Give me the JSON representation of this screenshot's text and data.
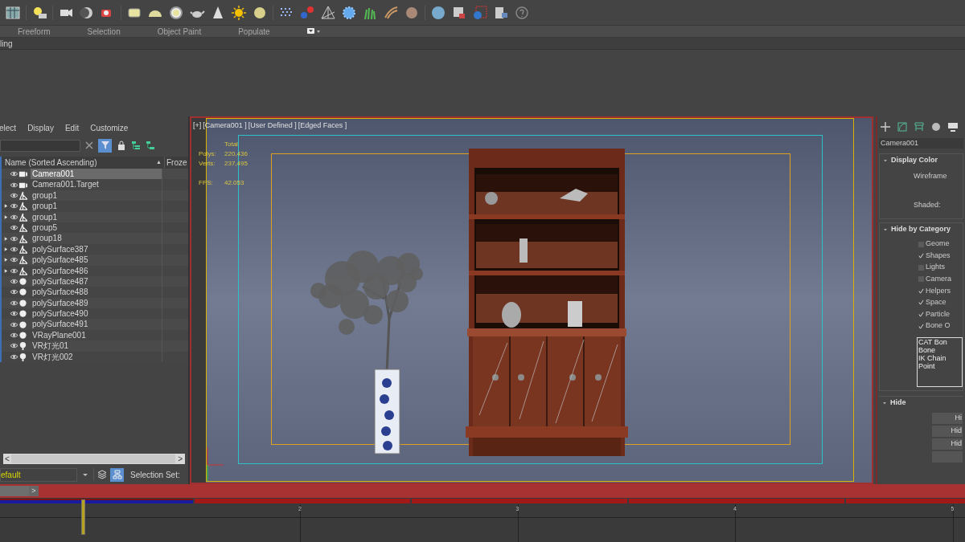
{
  "ribbon": {
    "tabs": [
      {
        "label": "Freeform",
        "selected": false
      },
      {
        "label": "Selection",
        "selected": false
      },
      {
        "label": "Object Paint",
        "selected": false
      },
      {
        "label": "Populate",
        "selected": false
      }
    ],
    "panel_tab": "ling"
  },
  "scene_explorer": {
    "menu": [
      "elect",
      "Display",
      "Edit",
      "Customize"
    ],
    "filter_active": true,
    "columns": [
      "Name (Sorted Ascending)",
      "Froze"
    ],
    "sort_mark": "▲",
    "rows": [
      {
        "name": "Camera001",
        "kind": "camera",
        "expander": false,
        "selected": true
      },
      {
        "name": "Camera001.Target",
        "kind": "camera",
        "expander": false,
        "selected": false
      },
      {
        "name": "group1",
        "kind": "shape",
        "expander": false,
        "selected": false
      },
      {
        "name": "group1",
        "kind": "shape",
        "expander": true,
        "selected": false
      },
      {
        "name": "group1",
        "kind": "shape",
        "expander": true,
        "selected": false
      },
      {
        "name": "group5",
        "kind": "shape",
        "expander": false,
        "selected": false
      },
      {
        "name": "group18",
        "kind": "shape",
        "expander": true,
        "selected": false
      },
      {
        "name": "polySurface387",
        "kind": "shape",
        "expander": true,
        "selected": false
      },
      {
        "name": "polySurface485",
        "kind": "shape",
        "expander": true,
        "selected": false
      },
      {
        "name": "polySurface486",
        "kind": "shape",
        "expander": true,
        "selected": false
      },
      {
        "name": "polySurface487",
        "kind": "geometry",
        "expander": false,
        "selected": false
      },
      {
        "name": "polySurface488",
        "kind": "geometry",
        "expander": false,
        "selected": false
      },
      {
        "name": "polySurface489",
        "kind": "geometry",
        "expander": false,
        "selected": false
      },
      {
        "name": "polySurface490",
        "kind": "geometry",
        "expander": false,
        "selected": false
      },
      {
        "name": "polySurface491",
        "kind": "geometry",
        "expander": false,
        "selected": false
      },
      {
        "name": "VRayPlane001",
        "kind": "geometry",
        "expander": false,
        "selected": false
      },
      {
        "name": "VR灯光01",
        "kind": "light",
        "expander": false,
        "selected": false
      },
      {
        "name": "VR灯光002",
        "kind": "light",
        "expander": false,
        "selected": false
      }
    ],
    "scroll_left": "<",
    "scroll_right": ">",
    "layer": "efault",
    "hierarchy_mode": true,
    "selection_set_label": "Selection Set:"
  },
  "viewport": {
    "labels": [
      "[+]",
      "[Camera001 ]",
      "[User Defined ]",
      "[Edged Faces ]"
    ],
    "stats_header": "Total",
    "stats": [
      {
        "label": "Polys:",
        "value": "220,436"
      },
      {
        "label": "Verts:",
        "value": "237,495"
      },
      {
        "label": "FPS:",
        "value": "42.053"
      }
    ]
  },
  "command_panel": {
    "object_name": "Camera001",
    "display_color": {
      "title": "Display Color",
      "labels": [
        "Wireframe",
        "Shaded:"
      ]
    },
    "hide_by_category": {
      "title": "Hide by Category",
      "checkboxes": [
        {
          "label": "Geome",
          "checked": false
        },
        {
          "label": "Shapes",
          "checked": true
        },
        {
          "label": "Lights",
          "checked": false
        },
        {
          "label": "Camera",
          "checked": false
        },
        {
          "label": "Helpers",
          "checked": true
        },
        {
          "label": "Space",
          "checked": true
        },
        {
          "label": "Particle",
          "checked": true
        },
        {
          "label": "Bone O",
          "checked": true
        }
      ],
      "list": [
        "CAT Bon",
        "Bone",
        "IK Chain",
        "Point"
      ]
    },
    "hide": {
      "title": "Hide",
      "buttons": [
        "Hi",
        "Hid",
        "Hid"
      ]
    }
  },
  "timeline": {
    "slider_next": ">",
    "ticks": [
      "2",
      "3",
      "4",
      "5"
    ]
  }
}
